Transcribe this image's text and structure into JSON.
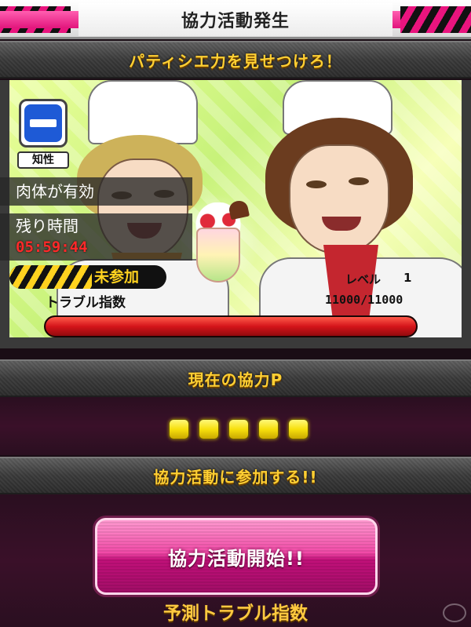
{
  "header": {
    "title": "協力活動発生"
  },
  "event": {
    "title": "パティシエ力を見せつけろ！",
    "attribute_label": "知性",
    "effect_text": "肉体が有効",
    "time_label": "残り時間",
    "time_value": "05:59:44",
    "status": "未参加",
    "level_label": "レベル",
    "level_value": "1",
    "trouble_label": "トラブル指数",
    "trouble_value": "11000/11000",
    "trouble_fraction": 1.0
  },
  "cooperation": {
    "points_header": "現在の協力P",
    "points_filled": 5,
    "join_header": "協力活動に参加する!!",
    "start_button": "協力活動開始!!",
    "forecast_label": "予測トラブル指数"
  },
  "colors": {
    "accent_pink": "#e2157c",
    "header_gold": "#ffcf33",
    "timer_red": "#ff2a2a",
    "hp_red": "#d4141a"
  },
  "icons": {
    "attribute": "intellect-no-entry-icon"
  }
}
